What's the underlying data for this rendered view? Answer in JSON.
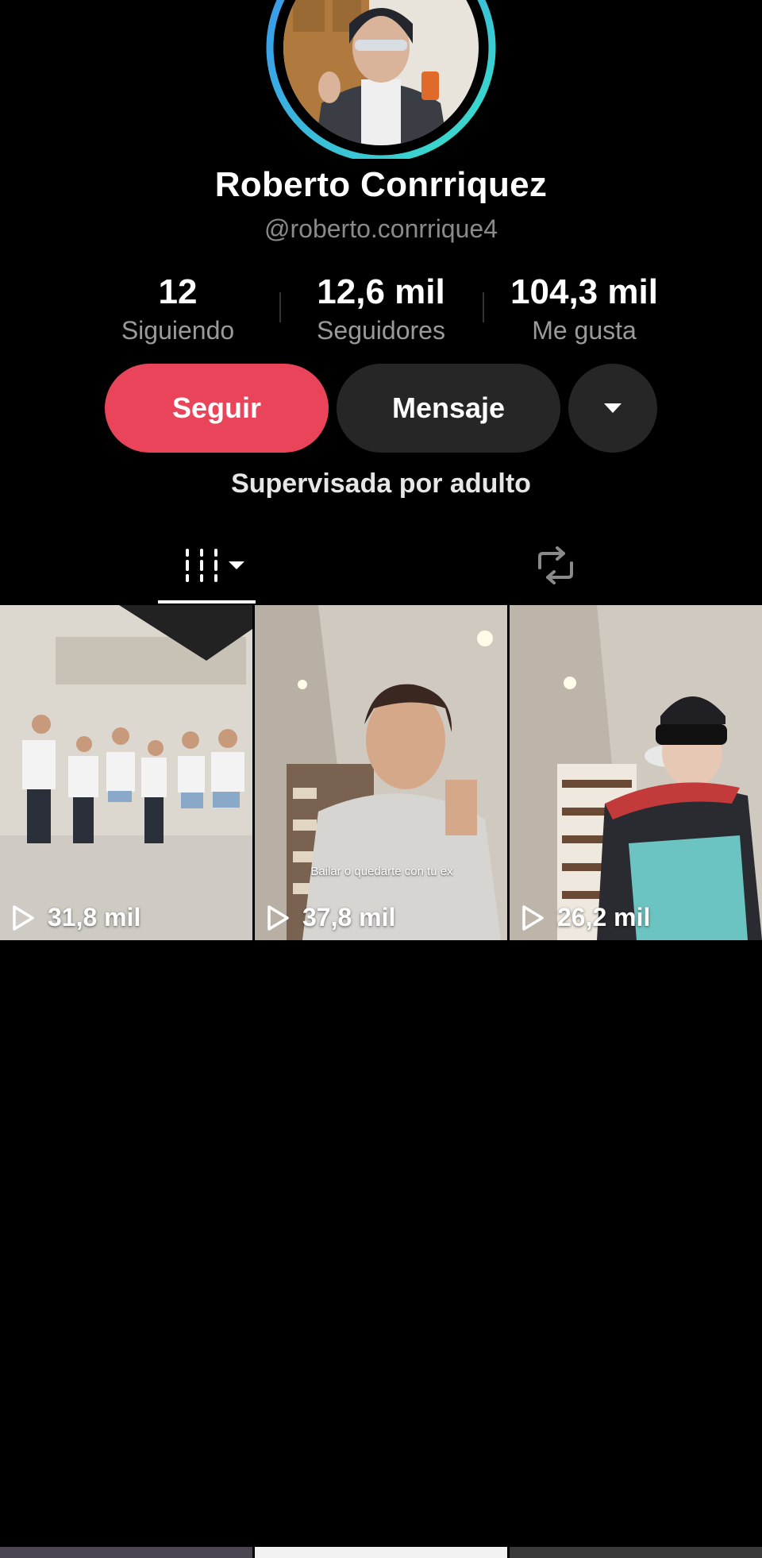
{
  "profile": {
    "name": "Roberto Conrriquez",
    "handle": "@roberto.conrrique4",
    "avatar_ring_colors": [
      "#3b8ff0",
      "#39e1c8"
    ]
  },
  "stats": [
    {
      "value": "12",
      "label": "Siguiendo"
    },
    {
      "value": "12,6 mil",
      "label": "Seguidores"
    },
    {
      "value": "104,3 mil",
      "label": "Me gusta"
    }
  ],
  "actions": {
    "follow_label": "Seguir",
    "message_label": "Mensaje",
    "more_icon": "caret-down-icon",
    "follow_color": "#e9445a"
  },
  "supervision_text": "Supervisada por adulto",
  "tabs": [
    {
      "icon": "video-grid-icon",
      "selected": true
    },
    {
      "icon": "repost-icon",
      "selected": false
    }
  ],
  "videos": [
    {
      "views": "31,8 mil",
      "caption": ""
    },
    {
      "views": "37,8 mil",
      "caption": "Bailar o quedarte con tu ex"
    },
    {
      "views": "26,2 mil",
      "caption": ""
    }
  ]
}
